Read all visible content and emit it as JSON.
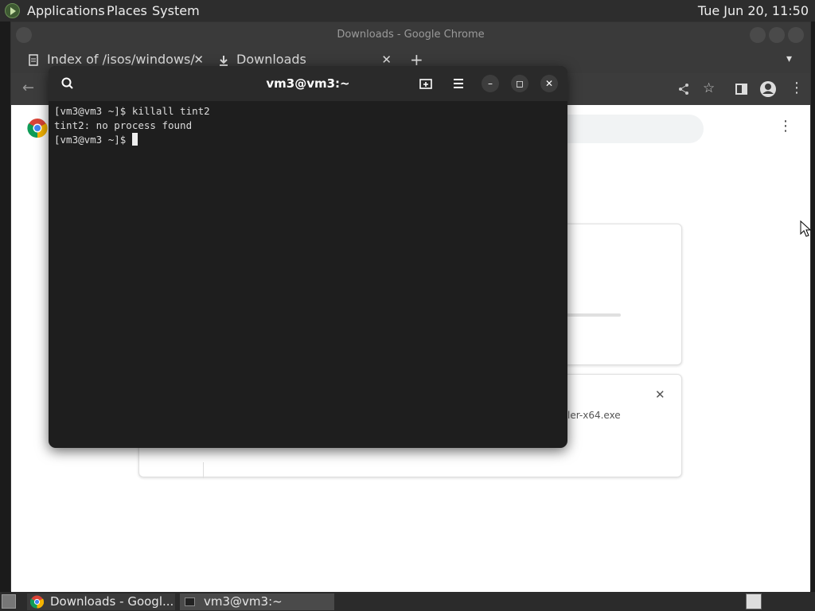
{
  "top_panel": {
    "menus": [
      "Applications",
      "Places",
      "System"
    ],
    "clock": "Tue Jun 20, 11:50"
  },
  "chrome": {
    "window_title": "Downloads - Google Chrome",
    "tabs": [
      {
        "label": "Index of /isos/windows/",
        "icon": "file-icon"
      },
      {
        "label": "Downloads",
        "icon": "download-icon"
      }
    ],
    "download_file_fragment": "ler-x64.exe"
  },
  "terminal": {
    "title": "vm3@vm3:~",
    "lines": [
      "[vm3@vm3 ~]$ killall tint2",
      "tint2: no process found",
      "[vm3@vm3 ~]$ "
    ]
  },
  "taskbar": {
    "tasks": [
      {
        "label": "Downloads - Googl...",
        "icon": "chrome-icon"
      },
      {
        "label": "vm3@vm3:~",
        "icon": "terminal-icon"
      }
    ]
  }
}
